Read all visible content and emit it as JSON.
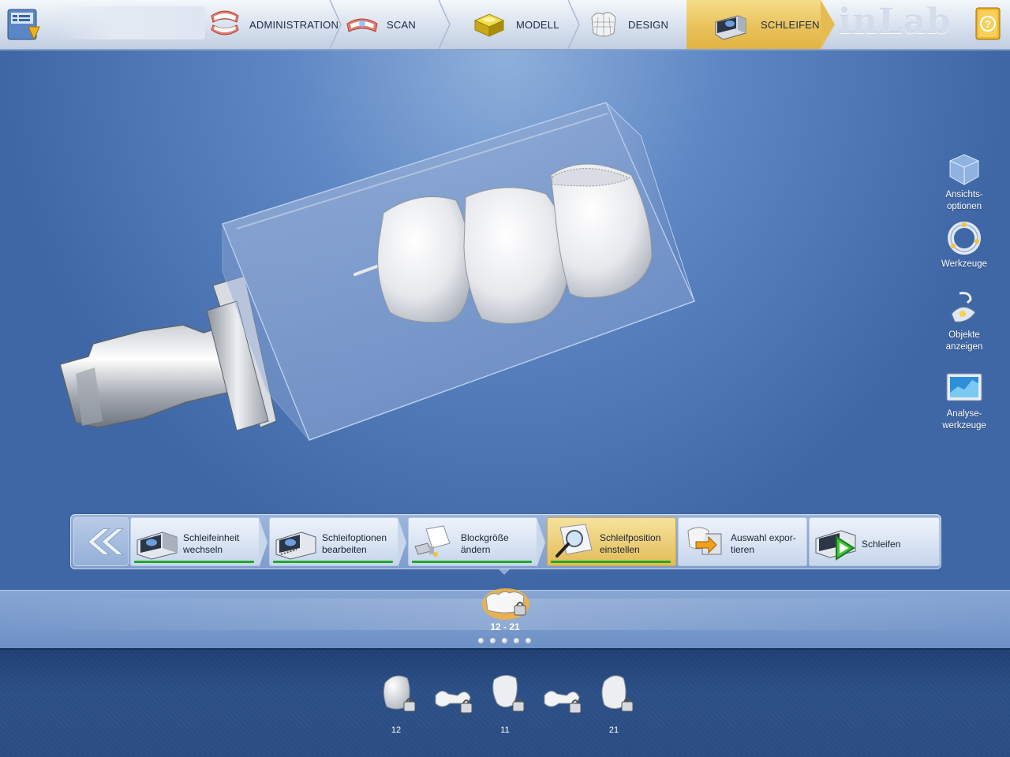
{
  "topbar": {
    "logo_text": "inLab",
    "steps": [
      {
        "label": "ADMINISTRATION",
        "icon": "dentures-icon"
      },
      {
        "label": "SCAN",
        "icon": "scan-jaw-icon"
      },
      {
        "label": "MODELL",
        "icon": "model-icon"
      },
      {
        "label": "DESIGN",
        "icon": "crown-design-icon"
      },
      {
        "label": "SCHLEIFEN",
        "icon": "milling-unit-icon",
        "active": true
      }
    ]
  },
  "right_tools": [
    {
      "line1": "Ansichts-",
      "line2": "optionen",
      "icon": "view-cube-icon"
    },
    {
      "line1": "Werkzeuge",
      "line2": "",
      "icon": "tool-ring-icon"
    },
    {
      "line1": "Objekte",
      "line2": "anzeigen",
      "icon": "lamp-icon"
    },
    {
      "line1": "Analyse-",
      "line2": "werkzeuge",
      "icon": "analysis-monitor-icon"
    }
  ],
  "actions": [
    {
      "line1": "Schleifeinheit",
      "line2": "wechseln",
      "done": true
    },
    {
      "line1": "Schleifoptionen",
      "line2": "bearbeiten",
      "done": true
    },
    {
      "line1": "Blockgröße",
      "line2": "ändern",
      "done": true
    },
    {
      "line1": "Schleifposition",
      "line2": "einstellen",
      "done": true,
      "current": true
    },
    {
      "line1": "Auswahl expor-",
      "line2": "tieren",
      "done": false
    },
    {
      "line1": "Schleifen",
      "line2": "",
      "done": false
    }
  ],
  "restoration_group": {
    "label": "12 - 21",
    "dot_count": 5
  },
  "teeth": [
    {
      "label": "12",
      "kind": "crown"
    },
    {
      "label": "",
      "kind": "connector"
    },
    {
      "label": "11",
      "kind": "crown"
    },
    {
      "label": "",
      "kind": "connector"
    },
    {
      "label": "21",
      "kind": "crown"
    }
  ],
  "colors": {
    "active_step": "#e9c25b",
    "progress": "#1faa2a",
    "viewport": "#3f67a6"
  }
}
